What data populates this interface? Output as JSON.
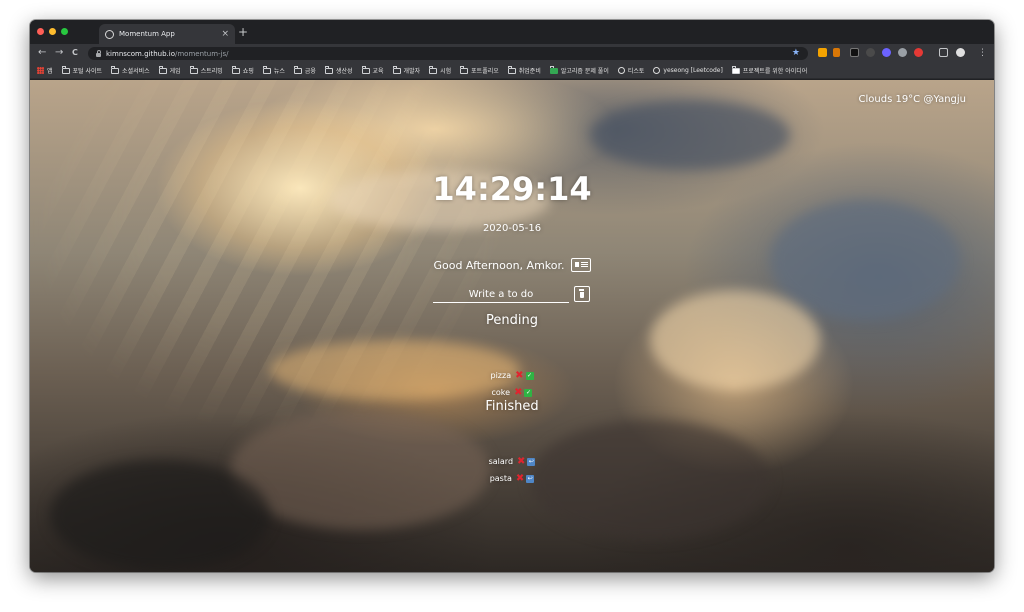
{
  "browser": {
    "tab_title": "Momentum App",
    "tab_close": "×",
    "new_tab": "+",
    "url_host": "kimnscom.github.io",
    "url_path": "/momentum-js/",
    "back": "←",
    "forward": "→",
    "reload": "C",
    "bookmark_star": "★",
    "menu": "⋮",
    "bookmarks": [
      {
        "label": "앱",
        "icon": "apps-grid-icon"
      },
      {
        "label": "포털 사이트",
        "icon": "folder-icon"
      },
      {
        "label": "소셜서비스",
        "icon": "folder-icon"
      },
      {
        "label": "게임",
        "icon": "folder-icon"
      },
      {
        "label": "스트리밍",
        "icon": "folder-icon"
      },
      {
        "label": "쇼핑",
        "icon": "folder-icon"
      },
      {
        "label": "뉴스",
        "icon": "folder-icon"
      },
      {
        "label": "금융",
        "icon": "folder-icon"
      },
      {
        "label": "생산성",
        "icon": "folder-icon"
      },
      {
        "label": "교육",
        "icon": "folder-icon"
      },
      {
        "label": "개발자",
        "icon": "folder-icon"
      },
      {
        "label": "시험",
        "icon": "folder-icon"
      },
      {
        "label": "포트폴리오",
        "icon": "folder-icon"
      },
      {
        "label": "취업준비",
        "icon": "folder-icon"
      },
      {
        "label": "알고리즘 문제 풀이",
        "icon": "sheet-icon"
      },
      {
        "label": "티스토",
        "icon": "globe-icon"
      },
      {
        "label": "yeseong [Leetcode]",
        "icon": "globe-icon"
      },
      {
        "label": "프로젝트를 위한 아이디어",
        "icon": "page-icon"
      }
    ]
  },
  "app": {
    "weather": "Clouds 19°C @Yangju",
    "clock": "14:29:14",
    "date": "2020-05-16",
    "greeting": "Good Afternoon, Amkor.",
    "todo_placeholder": "Write a to do",
    "pending_title": "Pending",
    "finished_title": "Finished",
    "delete_symbol": "✖",
    "done_symbol": "✓",
    "undo_symbol": "↩",
    "pending": [
      "pizza",
      "coke"
    ],
    "finished": [
      "salard",
      "pasta"
    ]
  },
  "colors": {
    "delete": "#e0242f",
    "done": "#2fb344",
    "undo": "#4f86c6"
  }
}
